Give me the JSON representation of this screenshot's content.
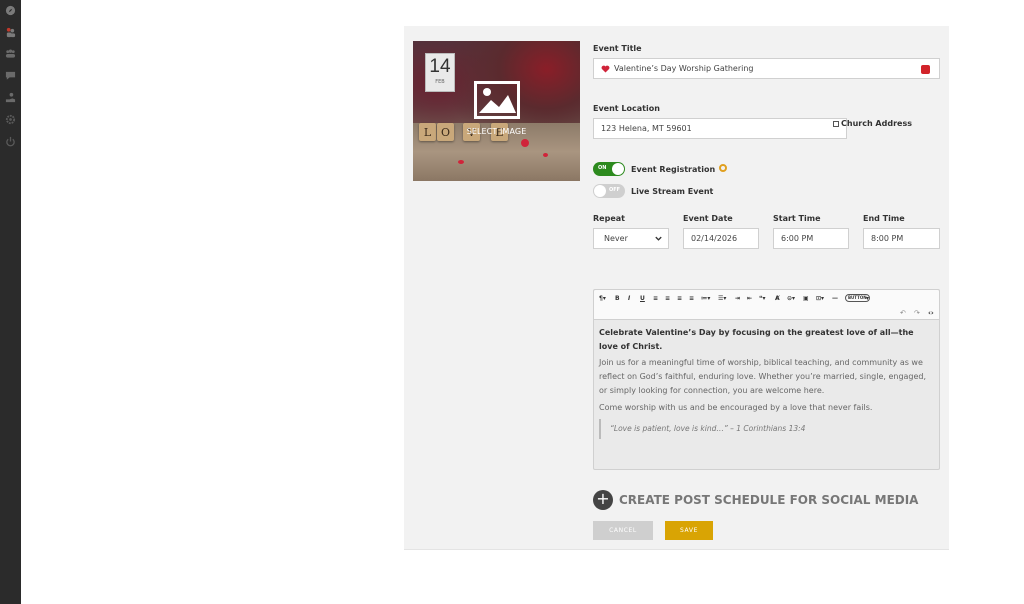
{
  "sidebar": {
    "icons": [
      "compass-icon",
      "users-icon",
      "group-icon",
      "chat-icon",
      "donate-icon",
      "gear-icon",
      "power-icon"
    ]
  },
  "event": {
    "image": {
      "day": "14",
      "month": "FEB",
      "select_label": "SELECT IMAGE",
      "tiles": [
        "L",
        "O",
        "V",
        "E"
      ]
    },
    "title_label": "Event Title",
    "title_value": "Valentine’s Day Worship Gathering",
    "location_label": "Event Location",
    "location_value": "123 Helena, MT 59601",
    "church_address_label": "Church Address",
    "registration": {
      "toggle_text": "ON",
      "label": "Event Registration",
      "on": true
    },
    "livestream": {
      "toggle_text": "OFF",
      "label": "Live Stream Event",
      "on": false
    },
    "repeat_label": "Repeat",
    "repeat_value": "Never",
    "date_label": "Event Date",
    "date_value": "02/14/2026",
    "start_label": "Start Time",
    "start_value": "6:00 PM",
    "end_label": "End Time",
    "end_value": "8:00 PM"
  },
  "editor": {
    "toolbar": [
      "¶▾",
      "B",
      "I",
      "U",
      "≡",
      "≡",
      "≡",
      "≡",
      "≔▾",
      "☰▾",
      "⇥",
      "⇤",
      "❝▾",
      "Ⱥ",
      "⊝▾",
      "▣",
      "⊡▾",
      "—",
      "BUTTON",
      "▾"
    ],
    "toolbar2": [
      "↶",
      "↷",
      "‹›"
    ],
    "lead": "Celebrate Valentine’s Day by focusing on the greatest love of all—the love of Christ.",
    "para1": "Join us for a meaningful time of worship, biblical teaching, and community as we reflect on God’s faithful, enduring love. Whether you’re married, single, engaged, or simply looking for connection, you are welcome here.",
    "para2": "Come worship with us and be encouraged by a love that never fails.",
    "quote": "“Love is patient, love is kind…” – 1 Corinthians 13:4"
  },
  "actions": {
    "create_social": "CREATE POST SCHEDULE FOR SOCIAL MEDIA",
    "cancel": "CANCEL",
    "save": "SAVE"
  },
  "colors": {
    "sidebar": "#2b2b2b",
    "toggle_on": "#2d8a1e",
    "save": "#d9a404",
    "cancel": "#cfcfcf"
  }
}
